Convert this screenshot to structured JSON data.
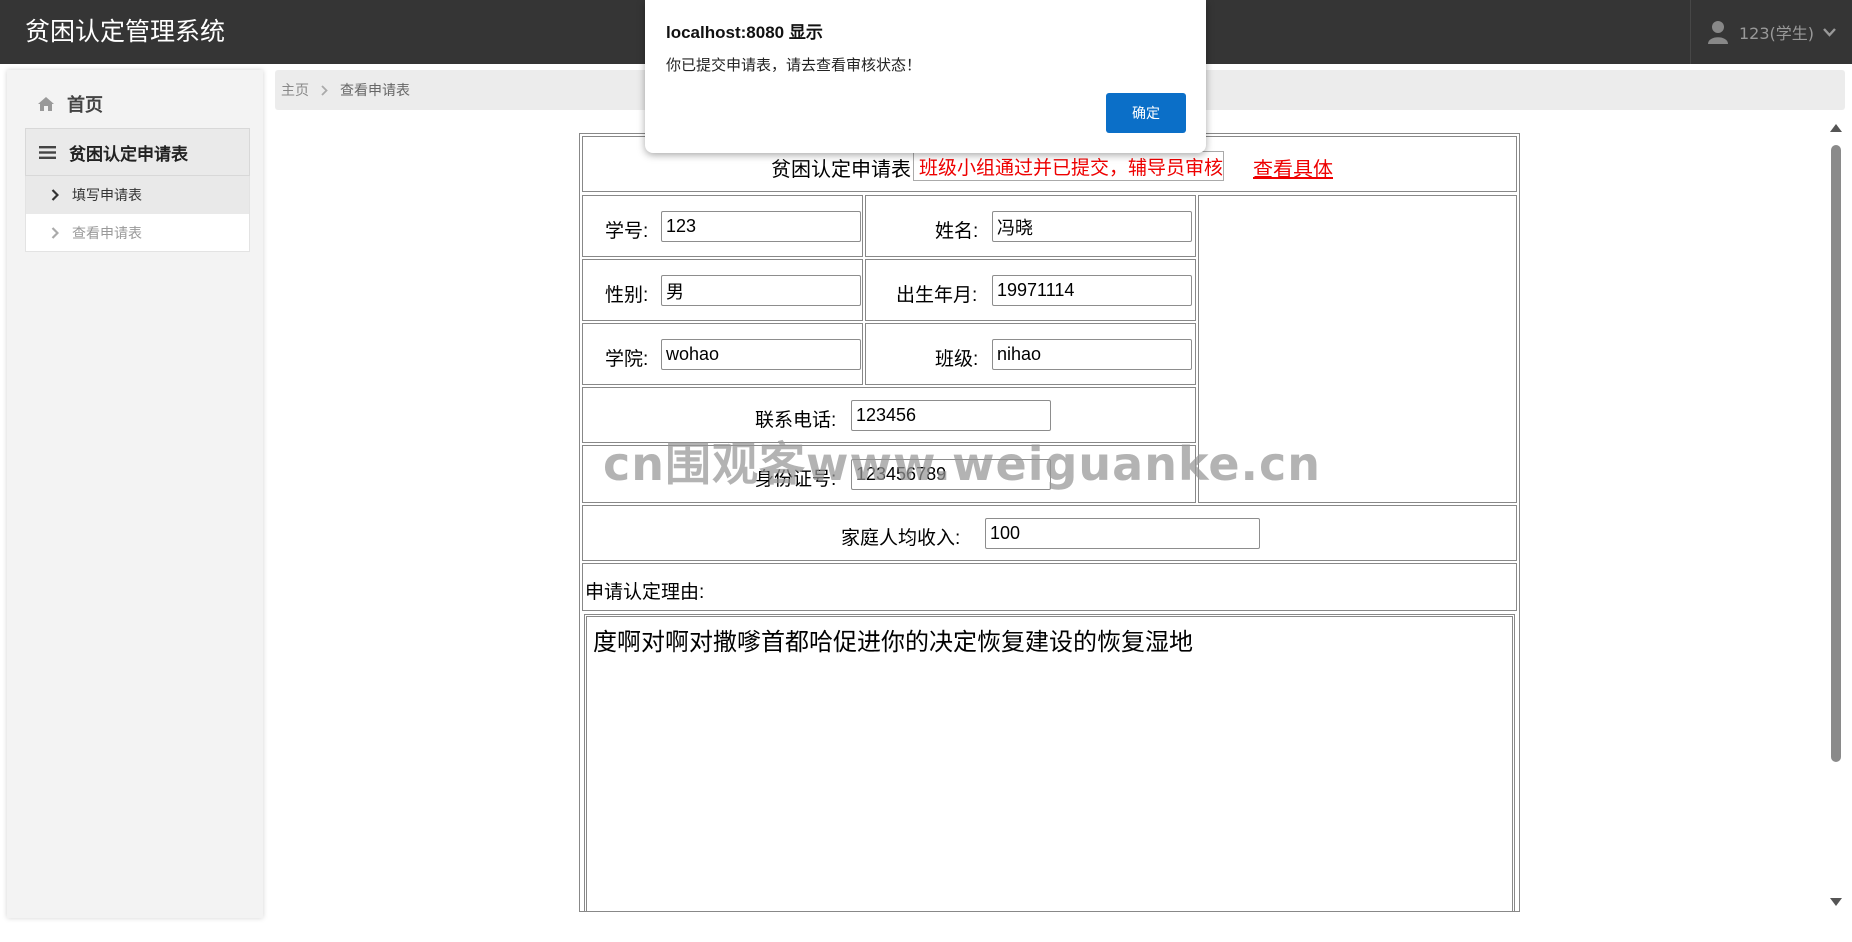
{
  "navbar": {
    "brand": "贫困认定管理系统",
    "user_label": "123(学生)"
  },
  "sidebar": {
    "home": "首页",
    "group": "贫困认定申请表",
    "items": [
      {
        "label": "填写申请表"
      },
      {
        "label": "查看申请表"
      }
    ]
  },
  "breadcrumb": {
    "home": "主页",
    "current": "查看申请表"
  },
  "form": {
    "title": "贫困认定申请表",
    "status": "班级小组通过并已提交，辅导员审核中",
    "detail_link": "查看具体",
    "student_id_label": "学号:",
    "student_id": "123",
    "name_label": "姓名:",
    "name": "冯晓",
    "gender_label": "性别:",
    "gender": "男",
    "birth_label": "出生年月:",
    "birth": "19971114",
    "college_label": "学院:",
    "college": "wohao",
    "class_label": "班级:",
    "class": "nihao",
    "phone_label": "联系电话:",
    "phone": "123456",
    "idcard_label": "身份证号:",
    "idcard": "123456789",
    "income_label": "家庭人均收入:",
    "income": "100",
    "reason_label": "申请认定理由:",
    "reason": "度啊对啊对撒嗲首都哈促进你的决定恢复建设的恢复湿地"
  },
  "watermark": "cn围观客www.weiguanke.cn",
  "dialog": {
    "title": "localhost:8080 显示",
    "message": "你已提交申请表，请去查看审核状态！",
    "ok": "确定"
  }
}
